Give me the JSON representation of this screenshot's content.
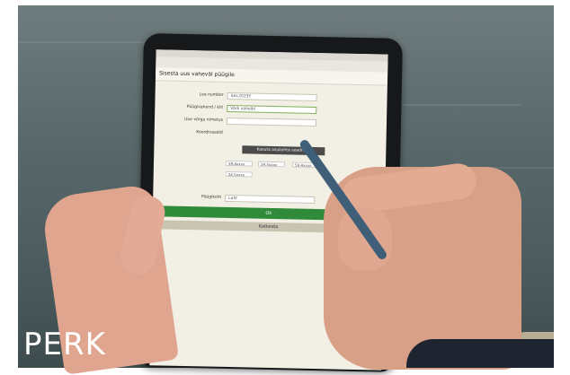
{
  "watermark": "PERK",
  "tablet_screen": {
    "title": "Sisesta uus vaheväl püügile",
    "fields": [
      {
        "label": "Loa number",
        "value": "SAL2023Y"
      },
      {
        "label": "Püügivahend / kiri",
        "value": "Võrk vahelbl"
      },
      {
        "label": "Uue võrgu nimetus",
        "value": ""
      },
      {
        "label": "Koordinaadid",
        "value": ""
      }
    ],
    "coord_button": "Kasuta asukohta seadmelt",
    "coords": [
      "59.4xxxx",
      "24.5xxxx",
      "59.4xxxx",
      "24.5xxxx"
    ],
    "fields_lower": [
      {
        "label": "Püügikoht",
        "value": "Laht"
      },
      {
        "label": "Püügile ID",
        "value": ""
      }
    ],
    "ok_label": "Ok",
    "cancel_label": "Katkesta"
  },
  "colors": {
    "ok_green": "#2f8a3a",
    "water": "#5a6a6c"
  }
}
